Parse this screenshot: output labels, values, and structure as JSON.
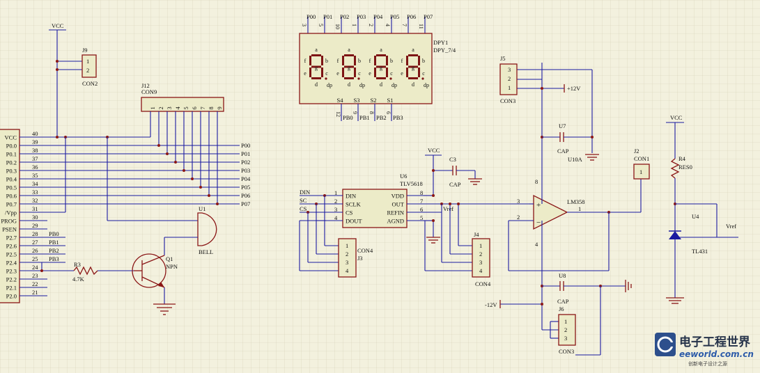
{
  "power": {
    "vcc": "VCC",
    "pos12": "+12V",
    "neg12": "-12V"
  },
  "mcu": {
    "pins": [
      {
        "name": "VCC",
        "num": "40"
      },
      {
        "name": "P0.0",
        "num": "39"
      },
      {
        "name": "P0.1",
        "num": "38"
      },
      {
        "name": "P0.2",
        "num": "37"
      },
      {
        "name": "P0.3",
        "num": "36"
      },
      {
        "name": "P0.4",
        "num": "35"
      },
      {
        "name": "P0.5",
        "num": "34"
      },
      {
        "name": "P0.6",
        "num": "33"
      },
      {
        "name": "P0.7",
        "num": "32"
      },
      {
        "name": "/Vpp",
        "num": "31"
      },
      {
        "name": "PROG",
        "num": "30"
      },
      {
        "name": "PSEN",
        "num": "29"
      },
      {
        "name": "P2.7",
        "num": "28"
      },
      {
        "name": "P2.6",
        "num": "27"
      },
      {
        "name": "P2.5",
        "num": "26"
      },
      {
        "name": "P2.4",
        "num": "25"
      },
      {
        "name": "P2.3",
        "num": "24"
      },
      {
        "name": "P2.2",
        "num": "23"
      },
      {
        "name": "P2.1",
        "num": "22"
      },
      {
        "name": "P2.0",
        "num": "21"
      }
    ],
    "netlabels": [
      "P00",
      "P01",
      "P02",
      "P03",
      "P04",
      "P05",
      "P06",
      "P07"
    ],
    "pblabels": [
      "PB0",
      "PB1",
      "PB2",
      "PB3"
    ]
  },
  "j9": {
    "ref": "J9",
    "type": "CON2",
    "pins": [
      "1",
      "2"
    ]
  },
  "j12": {
    "ref": "J12",
    "type": "CON9",
    "pins": [
      "1",
      "2",
      "3",
      "4",
      "5",
      "6",
      "7",
      "8",
      "9"
    ]
  },
  "u1": {
    "ref": "U1",
    "type": "BELL"
  },
  "q1": {
    "ref": "Q1",
    "type": "NPN"
  },
  "r3": {
    "ref": "R3",
    "value": "4.7K"
  },
  "dpy": {
    "ref": "DPY1",
    "type": "DPY_7/4",
    "topnets": [
      "P00",
      "P01",
      "P02",
      "P03",
      "P04",
      "P05",
      "P06",
      "P07"
    ],
    "toppins": [
      "3",
      "5",
      "10",
      "1",
      "2",
      "4",
      "7",
      "11"
    ],
    "seglabels": [
      "dp",
      "g",
      "f",
      "e",
      "d",
      "c",
      "b",
      "a"
    ],
    "digits": [
      {
        "a": "a",
        "b": "b",
        "c": "c",
        "d": "d",
        "e": "e",
        "f": "f",
        "g": "g",
        "dp": "dp"
      },
      {
        "a": "a",
        "b": "b",
        "c": "c",
        "d": "d",
        "e": "e",
        "f": "f",
        "g": "g",
        "dp": "dp"
      },
      {
        "a": "a",
        "b": "b",
        "c": "c",
        "d": "d",
        "e": "e",
        "f": "f",
        "g": "g",
        "dp": "dp"
      },
      {
        "a": "a",
        "b": "b",
        "c": "c",
        "d": "d",
        "e": "e",
        "f": "f",
        "g": "g",
        "dp": "dp"
      }
    ],
    "sel": [
      "S4",
      "S3",
      "S2",
      "S1"
    ],
    "botpins": [
      "12",
      "9",
      "8",
      "6"
    ],
    "botnets": [
      "PB0",
      "PB1",
      "PB2",
      "PB3"
    ]
  },
  "j5": {
    "ref": "J5",
    "type": "CON3",
    "pins": [
      "3",
      "2",
      "1"
    ]
  },
  "u7": {
    "ref": "U7",
    "type": "CAP"
  },
  "u10": {
    "ref": "U10A"
  },
  "u8": {
    "ref": "U8",
    "type": "CAP"
  },
  "c3": {
    "ref": "C3",
    "type": "CAP"
  },
  "u6": {
    "ref": "U6",
    "type": "TLV5618",
    "left": [
      {
        "name": "DIN",
        "num": "1"
      },
      {
        "name": "SCLK",
        "num": "2"
      },
      {
        "name": "CS",
        "num": "3"
      },
      {
        "name": "DOUT",
        "num": "4"
      }
    ],
    "right": [
      {
        "name": "VDD",
        "num": "8"
      },
      {
        "name": "OUT",
        "num": "7"
      },
      {
        "name": "REFIN",
        "num": "6"
      },
      {
        "name": "AGND",
        "num": "5"
      }
    ],
    "inputs": [
      "DIN",
      "SC",
      "CS"
    ],
    "vref": "Vref"
  },
  "j3": {
    "ref": "J3",
    "type": "CON4",
    "pins": [
      "1",
      "2",
      "3",
      "4"
    ]
  },
  "j4": {
    "ref": "J4",
    "type": "CON4",
    "pins": [
      "1",
      "2",
      "3",
      "4"
    ]
  },
  "j6": {
    "ref": "J6",
    "type": "CON3",
    "pins": [
      "1",
      "2",
      "3"
    ]
  },
  "j2": {
    "ref": "J2",
    "type": "CON1",
    "pins": [
      "1"
    ]
  },
  "opamp": {
    "type": "LM358",
    "plus": "+",
    "minus": "−",
    "pins": {
      "p3": "3",
      "p2": "2",
      "p1": "1",
      "p8": "8",
      "p4": "4"
    }
  },
  "r4": {
    "ref": "R4",
    "type": "RES0"
  },
  "u4": {
    "ref": "U4",
    "type": "TL431",
    "vref": "Vref"
  },
  "watermark": {
    "cn": "电子工程世界",
    "en": "eeworld.com.cn",
    "sub": "创新电子设计之源"
  }
}
